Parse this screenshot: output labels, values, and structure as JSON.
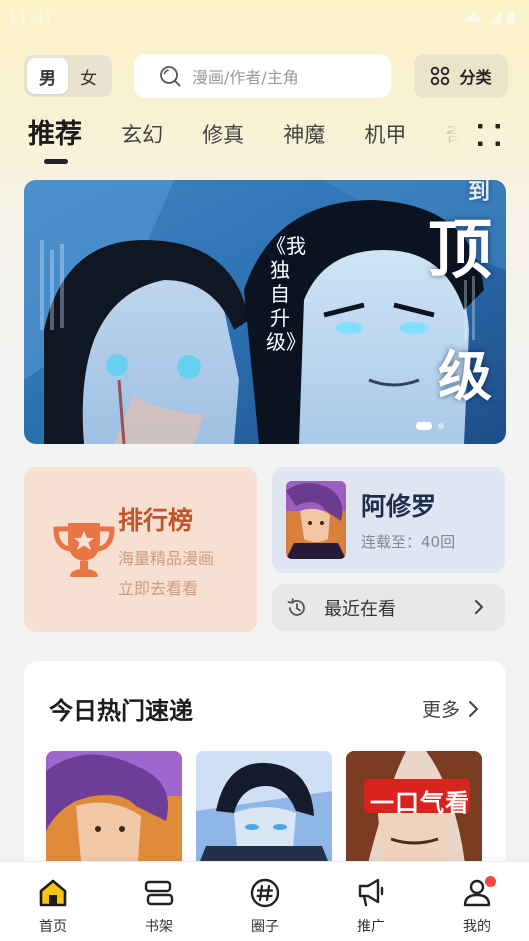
{
  "status_bar": {
    "time": "11:47"
  },
  "top_bar": {
    "gender": {
      "male": "男",
      "female": "女",
      "selected": "男"
    },
    "search": {
      "placeholder": "漫画/作者/主角"
    },
    "category_label": "分类"
  },
  "genre_tabs": [
    "推荐",
    "玄幻",
    "修真",
    "神魔",
    "机甲",
    "奇"
  ],
  "active_tab": "推荐",
  "banner": {
    "vertical_title": "《我独自升级》",
    "big_text_1": "顶",
    "big_text_2": "级",
    "corner_text": "到"
  },
  "ranking_card": {
    "title": "排行榜",
    "subtitle": "海量精品漫画",
    "cta": "立即去看看"
  },
  "continue_card": {
    "title": "阿修罗",
    "progress": "连载至：40回"
  },
  "recent": {
    "label": "最近在看"
  },
  "hot_section": {
    "title": "今日热门速递",
    "more_label": "更多",
    "third_cover_text": "一口气看"
  },
  "bottom_nav": {
    "items": [
      "首页",
      "书架",
      "圈子",
      "推广",
      "我的"
    ],
    "active": "首页",
    "badge_on": "我的"
  },
  "colors": {
    "accent_orange": "#e8623a",
    "ranking_bg": "#f7e0d1",
    "continue_bg": "#dfe5f1",
    "badge_red": "#f24a3c",
    "home_icon_yellow": "#f7c515"
  }
}
